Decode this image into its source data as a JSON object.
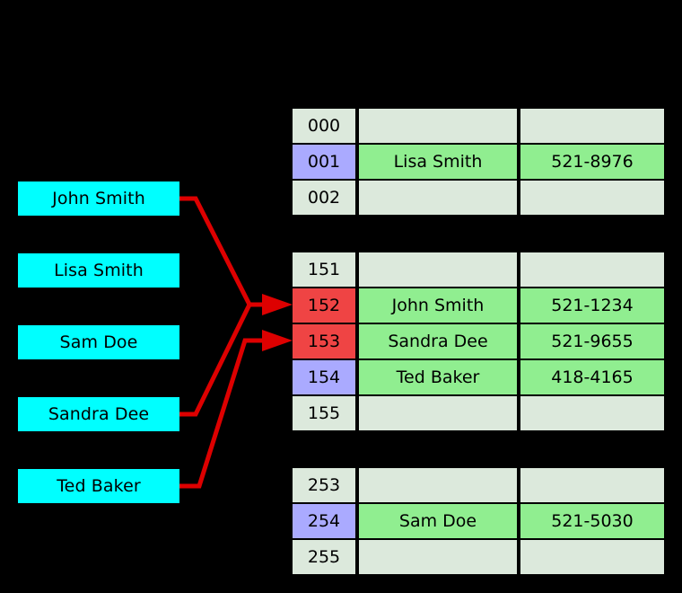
{
  "diagram": {
    "title": "hash-table-collision-diagram",
    "colors": {
      "background": "#000000",
      "key_box": "#00ffff",
      "arrow": "#dd0000",
      "cell_empty": "#dce9dc",
      "cell_filled": "#90ee90",
      "index_empty": "#dce9dc",
      "index_purple": "#aaaaff",
      "index_collision": "#ef4444"
    }
  },
  "keys": [
    {
      "label": "John Smith"
    },
    {
      "label": "Lisa Smith"
    },
    {
      "label": "Sam Doe"
    },
    {
      "label": "Sandra Dee"
    },
    {
      "label": "Ted Baker"
    }
  ],
  "buckets": [
    {
      "rows": [
        {
          "index": "000",
          "name": "",
          "phone": "",
          "index_state": "empty",
          "row_state": "empty"
        },
        {
          "index": "001",
          "name": "Lisa Smith",
          "phone": "521-8976",
          "index_state": "purple",
          "row_state": "filled"
        },
        {
          "index": "002",
          "name": "",
          "phone": "",
          "index_state": "empty",
          "row_state": "empty"
        }
      ]
    },
    {
      "rows": [
        {
          "index": "151",
          "name": "",
          "phone": "",
          "index_state": "empty",
          "row_state": "empty"
        },
        {
          "index": "152",
          "name": "John Smith",
          "phone": "521-1234",
          "index_state": "collision",
          "row_state": "filled"
        },
        {
          "index": "153",
          "name": "Sandra Dee",
          "phone": "521-9655",
          "index_state": "collision",
          "row_state": "filled"
        },
        {
          "index": "154",
          "name": "Ted Baker",
          "phone": "418-4165",
          "index_state": "purple",
          "row_state": "filled"
        },
        {
          "index": "155",
          "name": "",
          "phone": "",
          "index_state": "empty",
          "row_state": "empty"
        }
      ]
    },
    {
      "rows": [
        {
          "index": "253",
          "name": "",
          "phone": "",
          "index_state": "empty",
          "row_state": "empty"
        },
        {
          "index": "254",
          "name": "Sam Doe",
          "phone": "521-5030",
          "index_state": "purple",
          "row_state": "filled"
        },
        {
          "index": "255",
          "name": "",
          "phone": "",
          "index_state": "empty",
          "row_state": "empty"
        }
      ]
    }
  ]
}
